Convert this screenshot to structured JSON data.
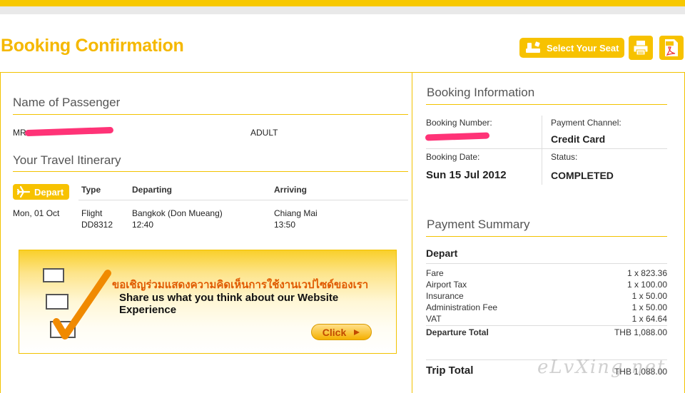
{
  "page_title": "Booking Confirmation",
  "toolbar": {
    "select_seat_label": "Select Your Seat",
    "print_icon": "printer-icon",
    "pdf_icon": "pdf-icon"
  },
  "passenger": {
    "heading": "Name of Passenger",
    "prefix": "MR",
    "type": "ADULT"
  },
  "itinerary": {
    "heading": "Your Travel Itinerary",
    "badge": "Depart",
    "columns": {
      "type": "Type",
      "departing": "Departing",
      "arriving": "Arriving"
    },
    "row": {
      "date": "Mon, 01 Oct",
      "type": "Flight",
      "flight_no": "DD8312",
      "dep_place": "Bangkok (Don Mueang)",
      "dep_time": "12:40",
      "arr_place": "Chiang Mai",
      "arr_time": "13:50"
    }
  },
  "banner": {
    "thai": "ขอเชิญร่วมแสดงความคิดเห็นการใช้งานเวปไซด์ของเรา",
    "english": "Share us what you think about our Website Experience",
    "click_label": "Click"
  },
  "booking_info": {
    "heading": "Booking Information",
    "number_label": "Booking Number:",
    "channel_label": "Payment Channel:",
    "channel_value": "Credit Card",
    "date_label": "Booking Date:",
    "date_value": "Sun 15 Jul 2012",
    "status_label": "Status:",
    "status_value": "COMPLETED"
  },
  "payment": {
    "heading": "Payment Summary",
    "section": "Depart",
    "items": [
      {
        "name": "Fare",
        "amount": "1 x 823.36"
      },
      {
        "name": "Airport Tax",
        "amount": "1 x 100.00"
      },
      {
        "name": "Insurance",
        "amount": "1 x 50.00"
      },
      {
        "name": "Administration Fee",
        "amount": "1 x 50.00"
      },
      {
        "name": "VAT",
        "amount": "1 x 64.64"
      }
    ],
    "departure_total_label": "Departure Total",
    "departure_total_value": "THB  1,088.00",
    "trip_total_label": "Trip Total",
    "trip_total_value": "THB 1,088.00"
  },
  "watermark": "eLvXing.net",
  "colors": {
    "accent": "#f5b800",
    "redaction": "#ff3377"
  }
}
